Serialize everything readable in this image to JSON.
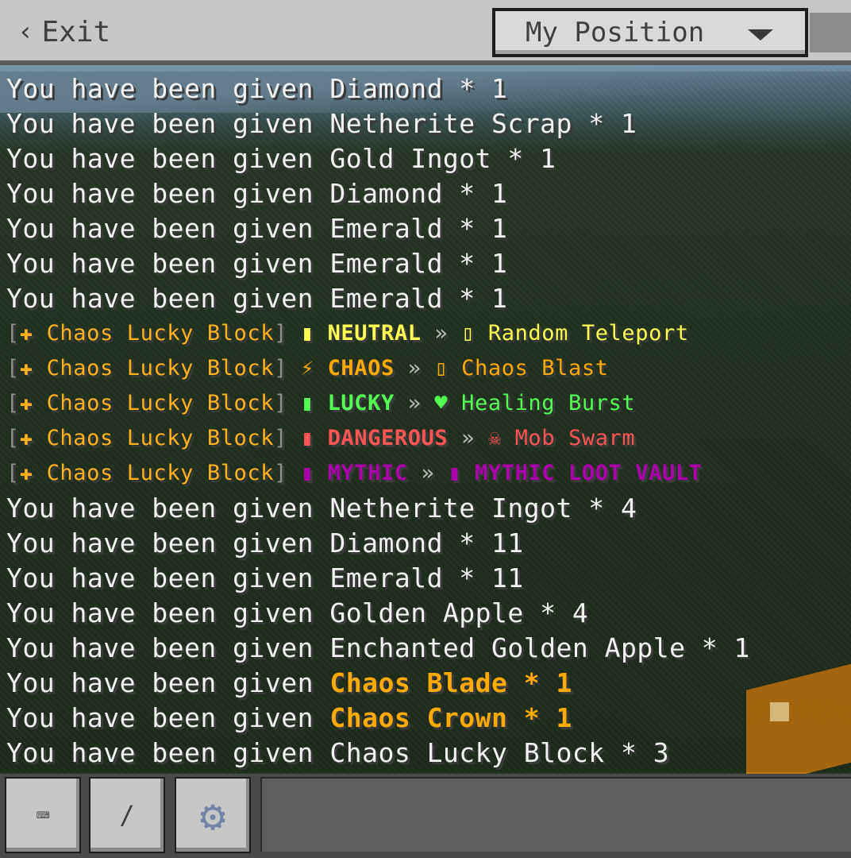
{
  "topbar": {
    "exit_label": "Exit",
    "position_select": {
      "selected": "My Position"
    }
  },
  "chat": {
    "lines": [
      {
        "type": "given",
        "prefix": "You have been given ",
        "item": "Diamond",
        "amount": " * 1"
      },
      {
        "type": "given",
        "prefix": "You have been given ",
        "item": "Netherite Scrap",
        "amount": " * 1"
      },
      {
        "type": "given",
        "prefix": "You have been given ",
        "item": "Gold Ingot",
        "amount": " * 1"
      },
      {
        "type": "given",
        "prefix": "You have been given ",
        "item": "Diamond",
        "amount": " * 1"
      },
      {
        "type": "given",
        "prefix": "You have been given ",
        "item": "Emerald",
        "amount": " * 1"
      },
      {
        "type": "given",
        "prefix": "You have been given ",
        "item": "Emerald",
        "amount": " * 1"
      },
      {
        "type": "given",
        "prefix": "You have been given ",
        "item": "Emerald",
        "amount": " * 1"
      },
      {
        "type": "lucky",
        "source": "Chaos Lucky Block",
        "marker": "▮",
        "category": "NEUTRAL",
        "event_icon": "▯",
        "event": "Random Teleport",
        "color": "#ffff55"
      },
      {
        "type": "lucky",
        "source": "Chaos Lucky Block",
        "marker": "⚡",
        "category": "CHAOS",
        "event_icon": "▯",
        "event": "Chaos Blast",
        "color": "#ffaa00"
      },
      {
        "type": "lucky",
        "source": "Chaos Lucky Block",
        "marker": "▮",
        "category": "LUCKY",
        "event_icon": "♥",
        "event": "Healing Burst",
        "color": "#55ff55"
      },
      {
        "type": "lucky",
        "source": "Chaos Lucky Block",
        "marker": "▮",
        "category": "DANGEROUS",
        "event_icon": "☠",
        "event": "Mob Swarm",
        "color": "#ff5555"
      },
      {
        "type": "lucky",
        "source": "Chaos Lucky Block",
        "marker": "▮",
        "category": "MYTHIC",
        "event_icon": "▮",
        "event": "MYTHIC LOOT VAULT",
        "color": "#aa00aa"
      },
      {
        "type": "given",
        "prefix": "You have been given ",
        "item": "Netherite Ingot",
        "amount": " * 4"
      },
      {
        "type": "given",
        "prefix": "You have been given ",
        "item": "Diamond",
        "amount": " * 11"
      },
      {
        "type": "given",
        "prefix": "You have been given ",
        "item": "Emerald",
        "amount": " * 11"
      },
      {
        "type": "given",
        "prefix": "You have been given ",
        "item": "Golden Apple",
        "amount": " * 4"
      },
      {
        "type": "given",
        "prefix": "You have been given ",
        "item": "Enchanted Golden Apple",
        "amount": " * 1"
      },
      {
        "type": "given-special",
        "prefix": "You have been given ",
        "item": "Chaos Blade * 1",
        "color": "#ffaa00"
      },
      {
        "type": "given-special",
        "prefix": "You have been given ",
        "item": "Chaos Crown * 1",
        "color": "#ffaa00"
      },
      {
        "type": "given",
        "prefix": "You have been given ",
        "item": "Chaos Lucky Block",
        "amount": " * 3"
      }
    ]
  },
  "bottombar": {
    "keyboard_icon": "keyboard-icon",
    "slash_label": "/",
    "settings_icon": "gear-icon"
  },
  "colors": {
    "chat_prefix": "#ffb21f",
    "bracket": "#8f8f8f",
    "separator": "#bdbdbd",
    "white_text": "#f2f2f2"
  }
}
